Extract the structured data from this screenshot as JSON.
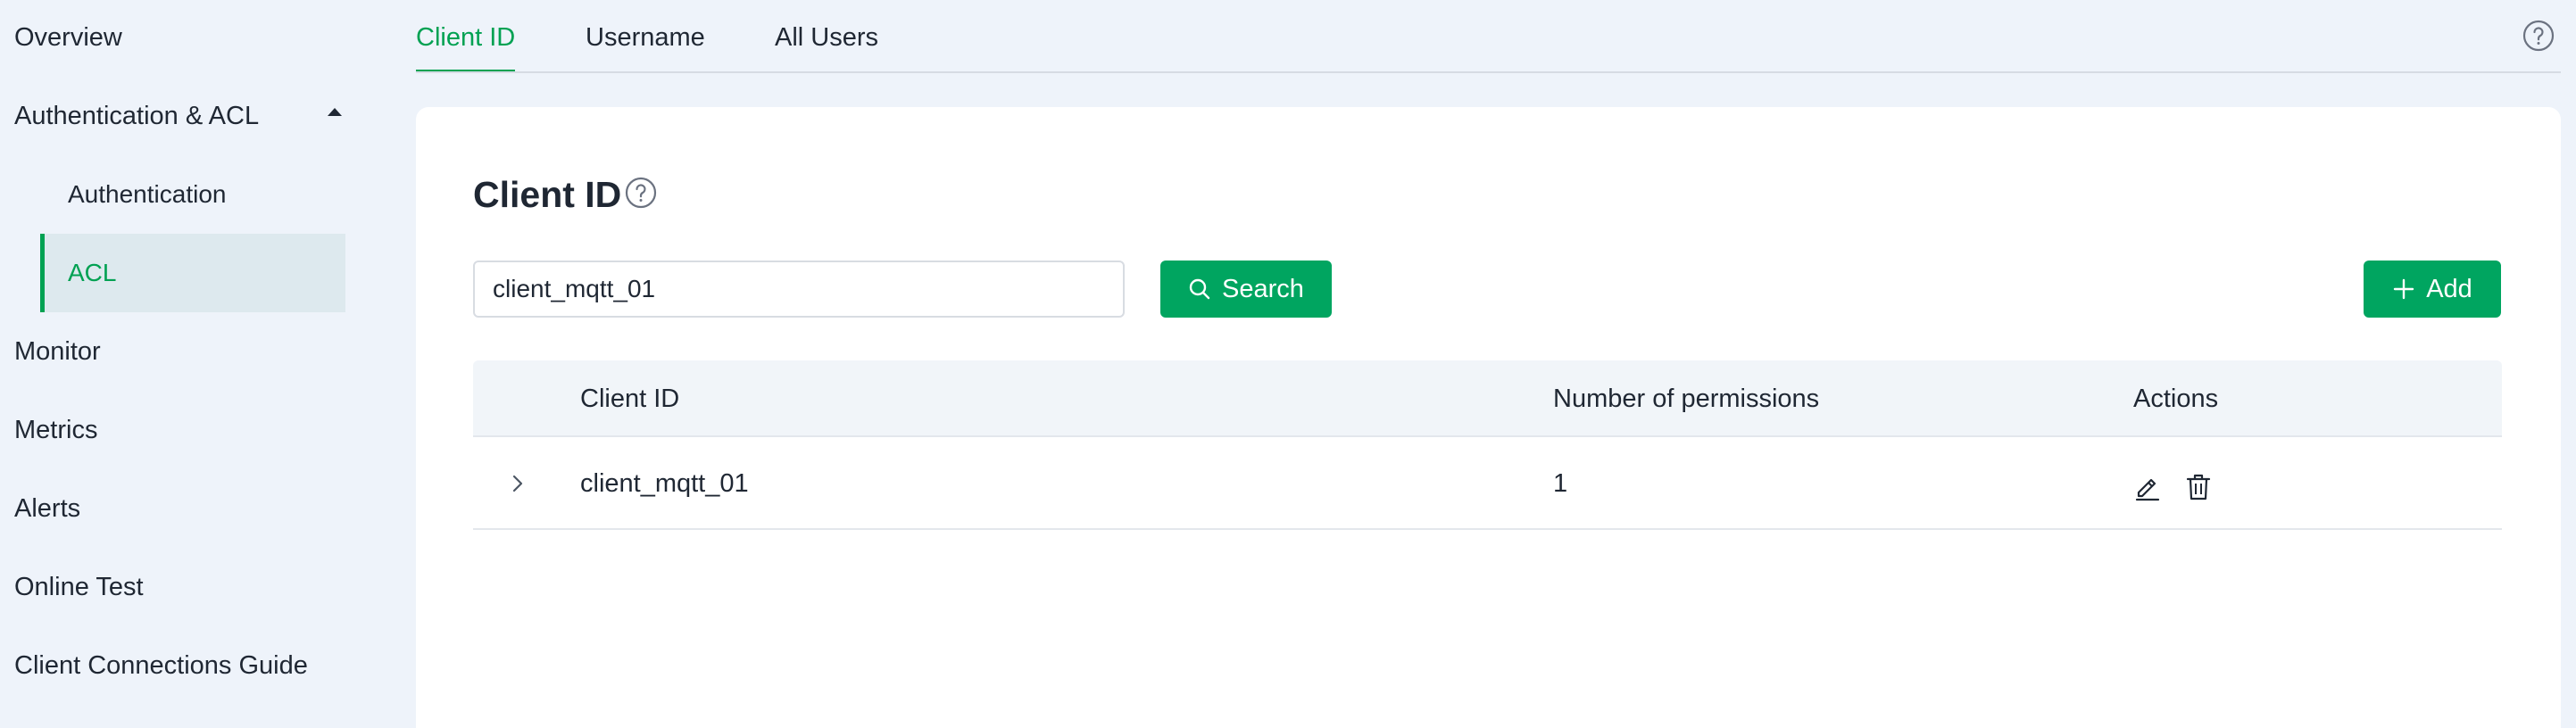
{
  "sidebar": {
    "items": [
      {
        "label": "Overview"
      },
      {
        "label": "Authentication & ACL"
      },
      {
        "label": "Monitor"
      },
      {
        "label": "Metrics"
      },
      {
        "label": "Alerts"
      },
      {
        "label": "Online Test"
      },
      {
        "label": "Client Connections Guide"
      }
    ],
    "subitems": [
      {
        "label": "Authentication"
      },
      {
        "label": "ACL"
      }
    ]
  },
  "tabs": [
    {
      "label": "Client ID"
    },
    {
      "label": "Username"
    },
    {
      "label": "All Users"
    }
  ],
  "page": {
    "title": "Client ID"
  },
  "search": {
    "value": "client_mqtt_01",
    "button_label": "Search"
  },
  "add_label": "Add",
  "table": {
    "headers": [
      "Client ID",
      "Number of permissions",
      "Actions"
    ],
    "rows": [
      {
        "client_id": "client_mqtt_01",
        "permissions": "1"
      }
    ]
  },
  "colors": {
    "accent": "#00a152",
    "sidebar_active_bg": "#dde9ee",
    "page_bg": "#eef3fa"
  },
  "icons": [
    "help-circle-icon",
    "caret-up-icon",
    "search-icon",
    "plus-icon",
    "chevron-right-icon",
    "edit-icon",
    "trash-icon"
  ]
}
